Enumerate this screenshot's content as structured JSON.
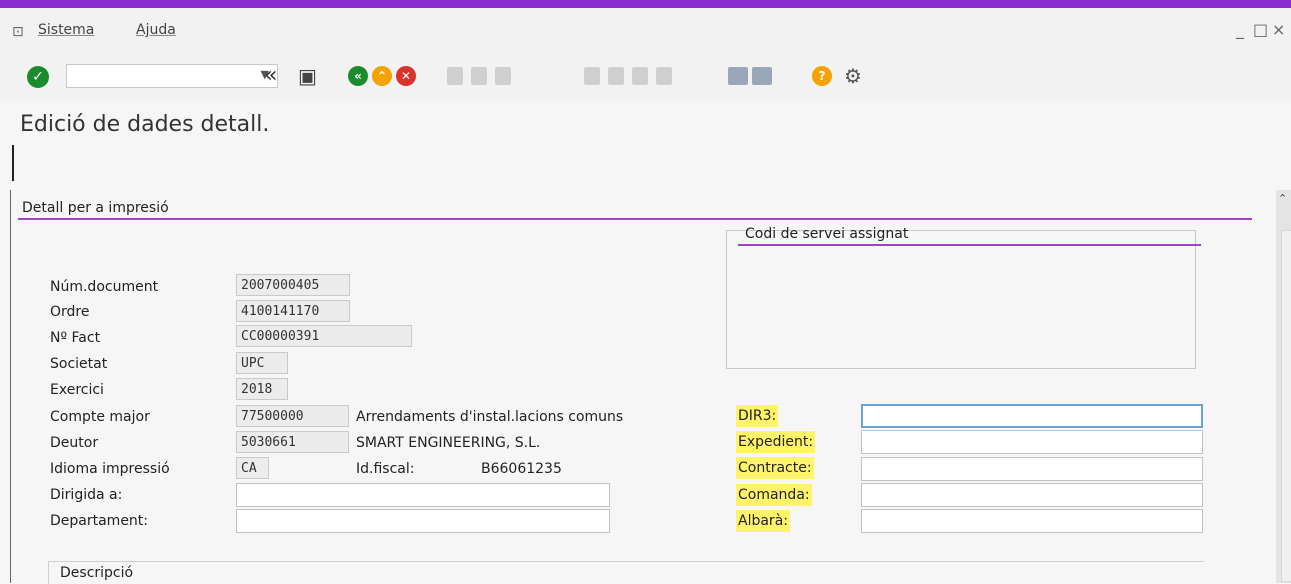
{
  "menu": {
    "items": [
      "Sistema",
      "Ajuda"
    ]
  },
  "window_controls": [
    "_",
    "□",
    "×"
  ],
  "toolbar": {
    "command_field": ""
  },
  "title": "Edició de dades detall.",
  "group_main": "Detall per a impresió",
  "group_service": "Codi de servei assignat",
  "group_desc": "Descripció",
  "fields": {
    "num_document": {
      "label": "Núm.document",
      "value": "2007000405"
    },
    "ordre": {
      "label": "Ordre",
      "value": "4100141170"
    },
    "n_fact": {
      "label": "Nº Fact",
      "value": "CC00000391"
    },
    "societat": {
      "label": "Societat",
      "value": "UPC"
    },
    "exercici": {
      "label": "Exercici",
      "value": "2018"
    },
    "compte_major": {
      "label": "Compte major",
      "value": "77500000",
      "desc": "Arrendaments d'instal.lacions comuns"
    },
    "deutor": {
      "label": "Deutor",
      "value": "5030661",
      "desc": "SMART ENGINEERING, S.L."
    },
    "idioma": {
      "label": "Idioma impressió",
      "value": "CA",
      "idfiscal_label": "Id.fiscal:",
      "idfiscal_value": "B66061235"
    },
    "dirigida": {
      "label": "Dirigida a:",
      "value": ""
    },
    "departament": {
      "label": "Departament:",
      "value": ""
    }
  },
  "right_fields": {
    "dir3": {
      "label": "DIR3:",
      "value": ""
    },
    "expedient": {
      "label": "Expedient:",
      "value": ""
    },
    "contracte": {
      "label": "Contracte:",
      "value": ""
    },
    "comanda": {
      "label": "Comanda:",
      "value": ""
    },
    "albara": {
      "label": "Albarà:",
      "value": ""
    }
  },
  "colors": {
    "accent": "#8a2bd1",
    "ok": "#1c8b2d",
    "green": "#1c8b2d",
    "orange": "#f5a300",
    "red": "#d9342b",
    "highlight": "#fff36b"
  }
}
